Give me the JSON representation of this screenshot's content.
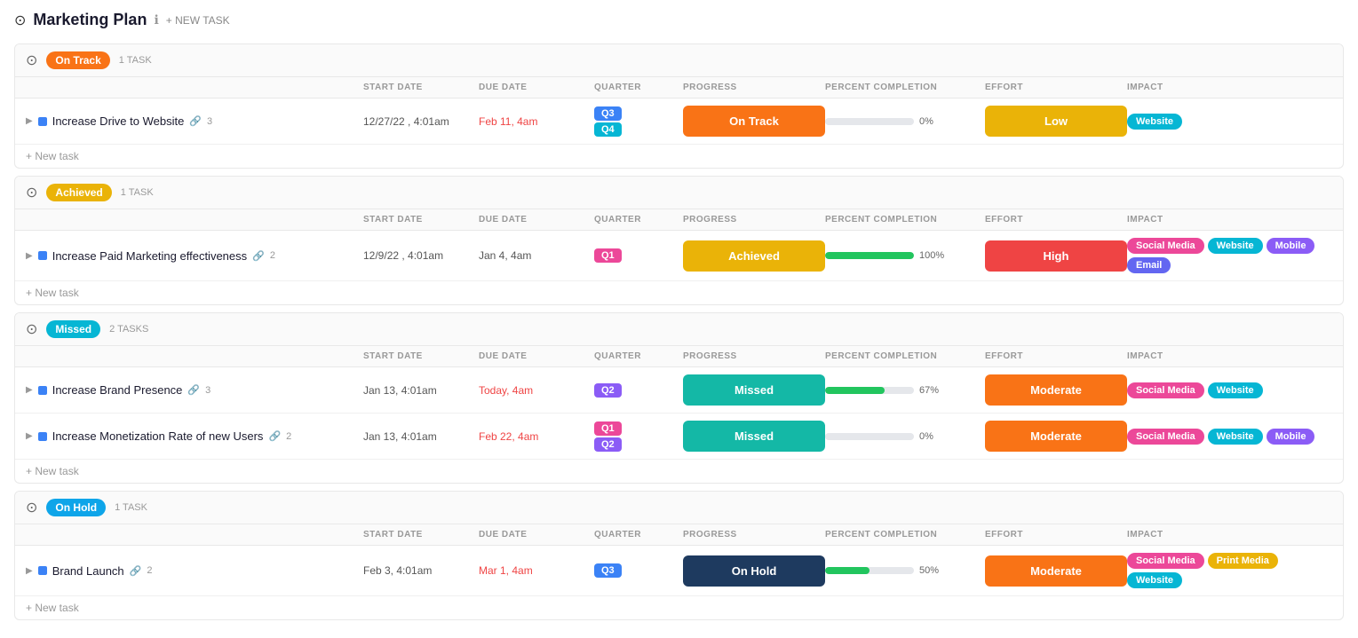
{
  "header": {
    "title": "Marketing Plan",
    "new_task_label": "+ NEW TASK"
  },
  "sections": [
    {
      "id": "ontrack",
      "status": "On Track",
      "badge_class": "badge-ontrack",
      "task_count": "1 TASK",
      "tasks": [
        {
          "name": "Increase Drive to Website",
          "subtask_icon": "🔗",
          "subtask_count": "3",
          "start_date": "12/27/22 , 4:01am",
          "due_date": "Feb 11, 4am",
          "due_date_class": "date-red",
          "quarters": [
            {
              "label": "Q3",
              "class": "q3"
            },
            {
              "label": "Q4",
              "class": "q4"
            }
          ],
          "progress": "On Track",
          "progress_class": "pill-ontrack",
          "percent": 0,
          "effort": "Low",
          "effort_class": "effort-low",
          "impacts": [
            {
              "label": "Website",
              "class": "tag-website"
            }
          ]
        }
      ]
    },
    {
      "id": "achieved",
      "status": "Achieved",
      "badge_class": "badge-achieved",
      "task_count": "1 TASK",
      "tasks": [
        {
          "name": "Increase Paid Marketing effectiveness",
          "subtask_icon": "🔗",
          "subtask_count": "2",
          "start_date": "12/9/22 , 4:01am",
          "due_date": "Jan 4, 4am",
          "due_date_class": "",
          "quarters": [
            {
              "label": "Q1",
              "class": "q1"
            }
          ],
          "progress": "Achieved",
          "progress_class": "pill-achieved",
          "percent": 100,
          "effort": "High",
          "effort_class": "effort-high",
          "impacts": [
            {
              "label": "Social Media",
              "class": "tag-socialmedia"
            },
            {
              "label": "Website",
              "class": "tag-website"
            },
            {
              "label": "Mobile",
              "class": "tag-mobile"
            },
            {
              "label": "Email",
              "class": "tag-email"
            }
          ]
        }
      ]
    },
    {
      "id": "missed",
      "status": "Missed",
      "badge_class": "badge-missed",
      "task_count": "2 TASKS",
      "tasks": [
        {
          "name": "Increase Brand Presence",
          "subtask_icon": "🔗",
          "subtask_count": "3",
          "start_date": "Jan 13, 4:01am",
          "due_date": "Today, 4am",
          "due_date_class": "date-today",
          "quarters": [
            {
              "label": "Q2",
              "class": "q2"
            }
          ],
          "progress": "Missed",
          "progress_class": "pill-missed",
          "percent": 67,
          "effort": "Moderate",
          "effort_class": "effort-moderate",
          "impacts": [
            {
              "label": "Social Media",
              "class": "tag-socialmedia"
            },
            {
              "label": "Website",
              "class": "tag-website"
            }
          ]
        },
        {
          "name": "Increase Monetization Rate of new Users",
          "subtask_icon": "🔗",
          "subtask_count": "2",
          "start_date": "Jan 13, 4:01am",
          "due_date": "Feb 22, 4am",
          "due_date_class": "date-red",
          "quarters": [
            {
              "label": "Q1",
              "class": "q1"
            },
            {
              "label": "Q2",
              "class": "q2"
            }
          ],
          "progress": "Missed",
          "progress_class": "pill-missed",
          "percent": 0,
          "effort": "Moderate",
          "effort_class": "effort-moderate",
          "impacts": [
            {
              "label": "Social Media",
              "class": "tag-socialmedia"
            },
            {
              "label": "Website",
              "class": "tag-website"
            },
            {
              "label": "Mobile",
              "class": "tag-mobile"
            }
          ]
        }
      ]
    },
    {
      "id": "onhold",
      "status": "On Hold",
      "badge_class": "badge-onhold",
      "task_count": "1 TASK",
      "tasks": [
        {
          "name": "Brand Launch",
          "subtask_icon": "🔗",
          "subtask_count": "2",
          "start_date": "Feb 3, 4:01am",
          "due_date": "Mar 1, 4am",
          "due_date_class": "date-red",
          "quarters": [
            {
              "label": "Q3",
              "class": "q3"
            }
          ],
          "progress": "On Hold",
          "progress_class": "pill-onhold",
          "percent": 50,
          "effort": "Moderate",
          "effort_class": "effort-moderate",
          "impacts": [
            {
              "label": "Social Media",
              "class": "tag-socialmedia"
            },
            {
              "label": "Print Media",
              "class": "tag-printmedia"
            },
            {
              "label": "Website",
              "class": "tag-website"
            }
          ]
        }
      ]
    }
  ],
  "columns": {
    "start_date": "START DATE",
    "due_date": "DUE DATE",
    "quarter": "QUARTER",
    "progress": "PROGRESS",
    "percent_completion": "PERCENT COMPLETION",
    "effort": "EFFORT",
    "impact": "IMPACT"
  },
  "new_task": "+ New task"
}
